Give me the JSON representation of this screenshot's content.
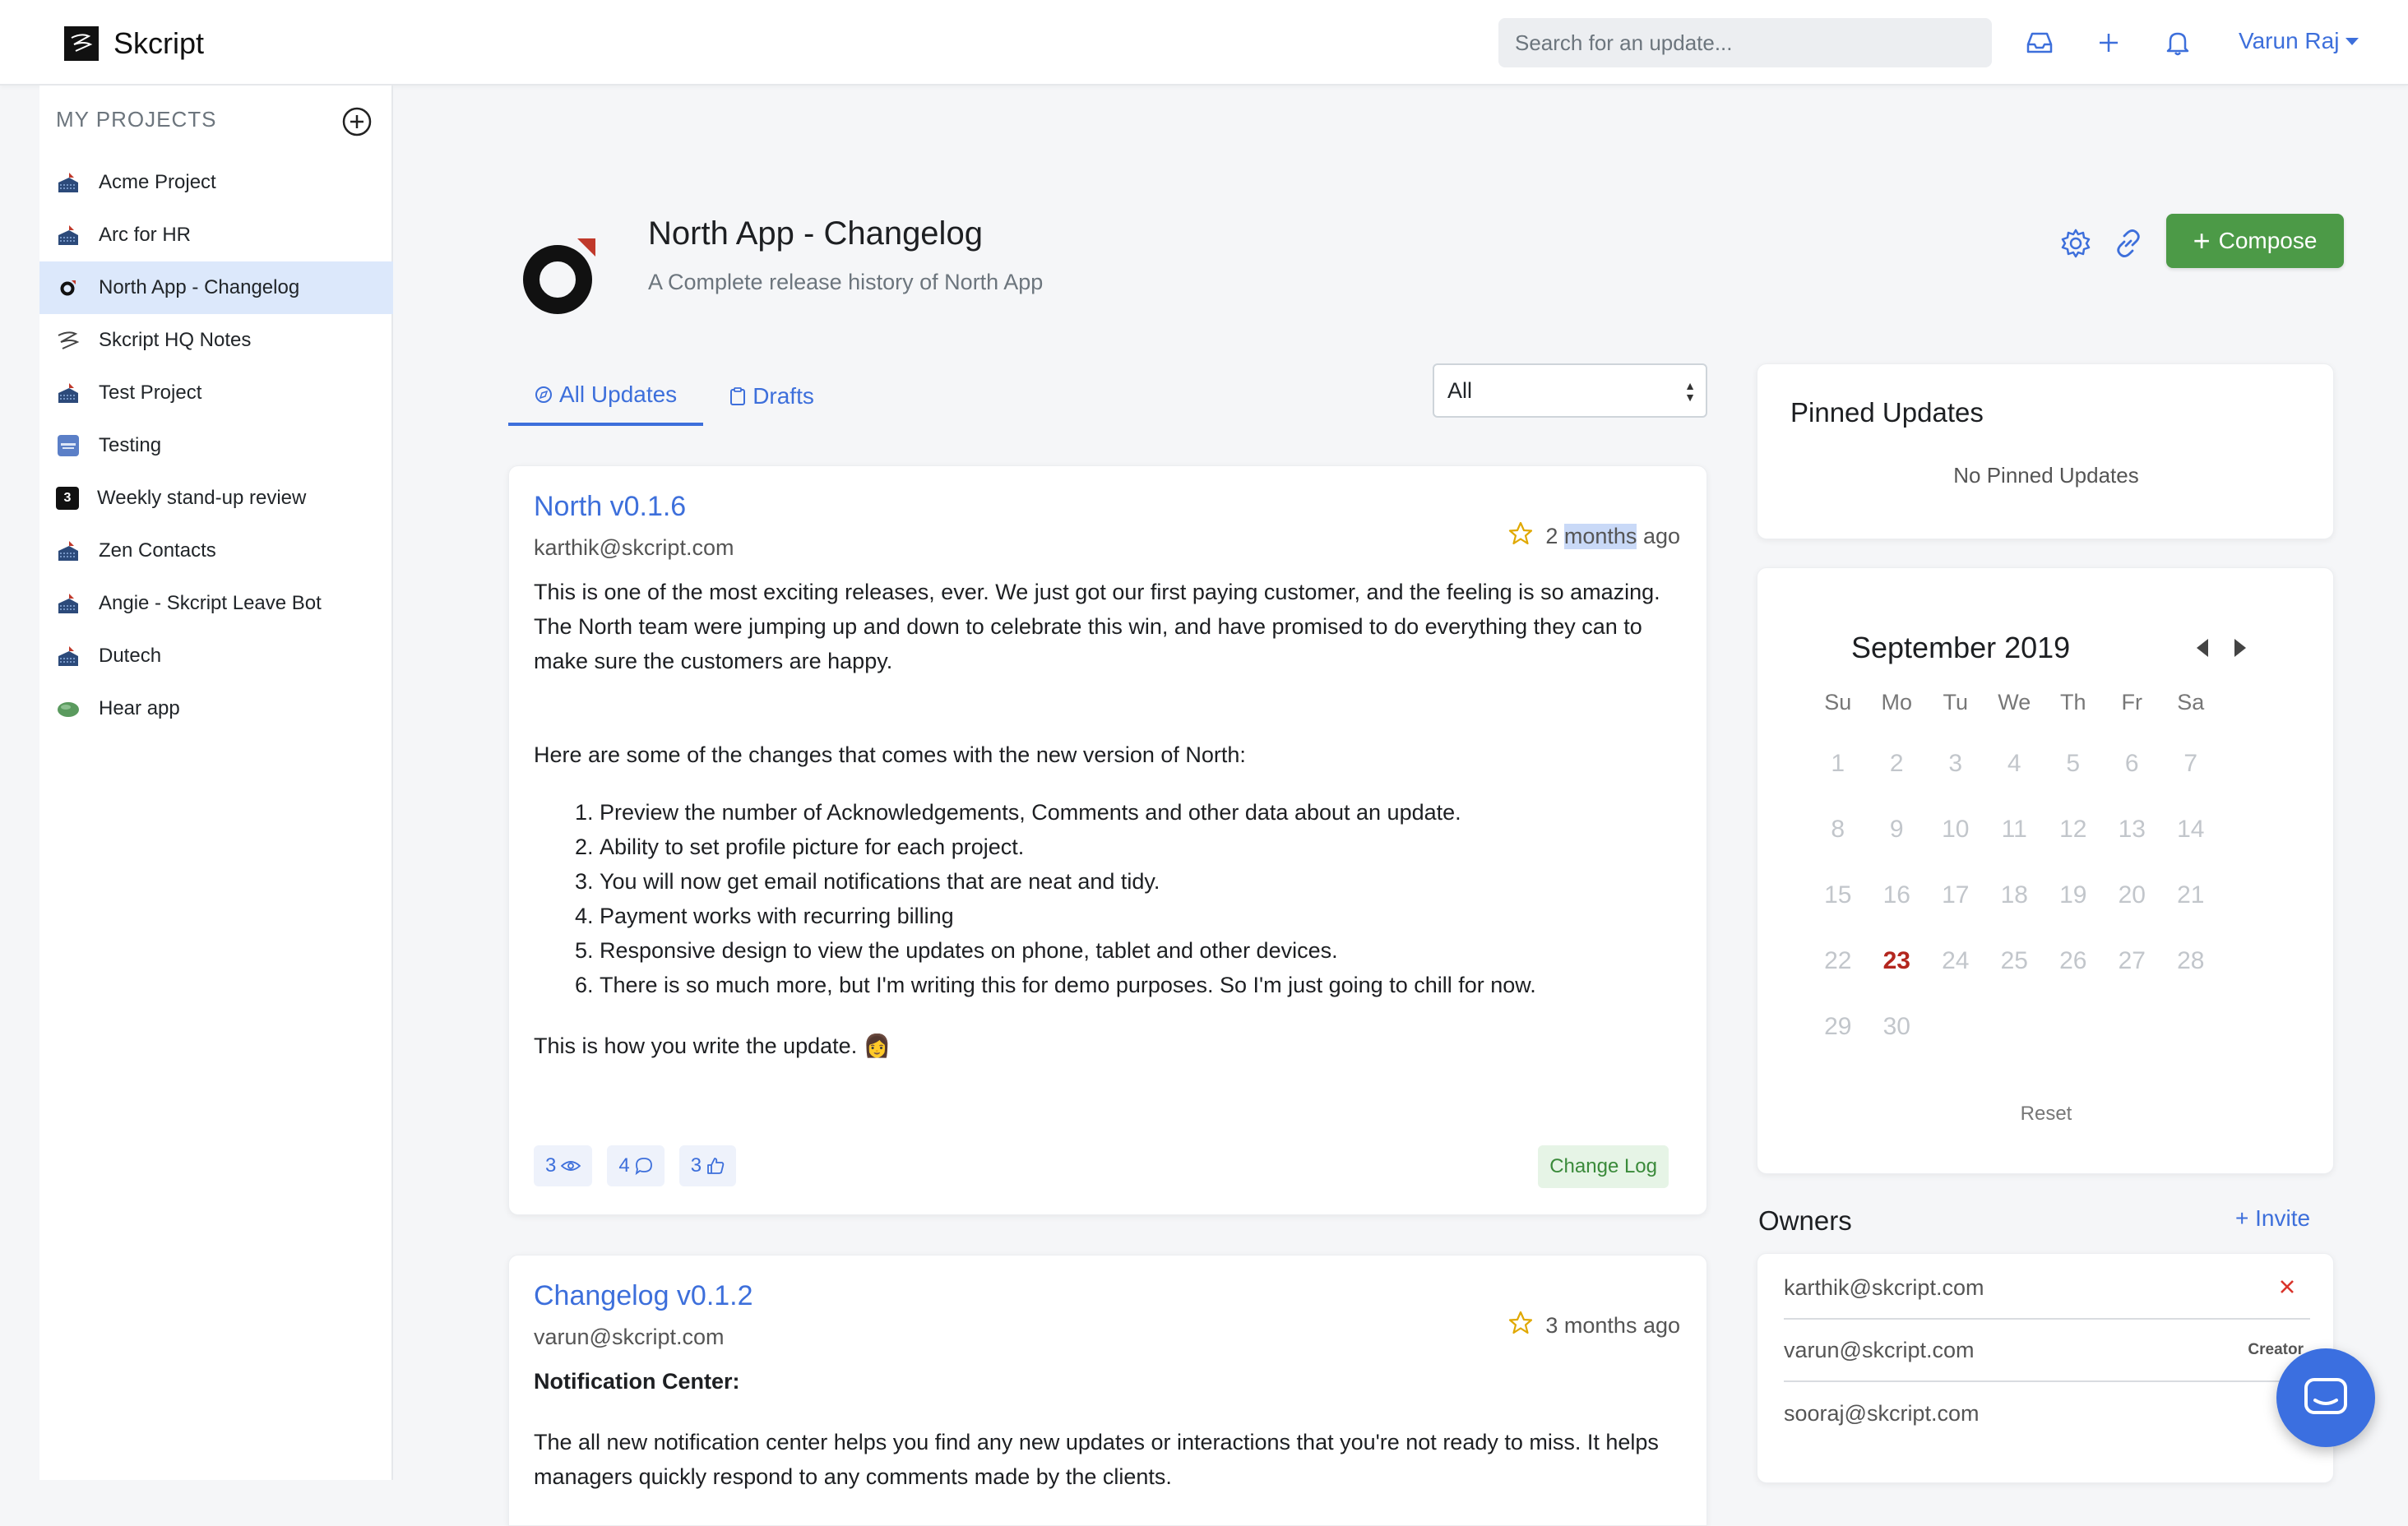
{
  "nav": {
    "brand": "Skcript",
    "search_placeholder": "Search for an update...",
    "user": "Varun Raj"
  },
  "sidebar": {
    "heading": "MY PROJECTS",
    "items": [
      {
        "label": "Acme Project",
        "icon": "ship-icon"
      },
      {
        "label": "Arc for HR",
        "icon": "ship-icon"
      },
      {
        "label": "North App - Changelog",
        "icon": "north-logo-icon",
        "active": true
      },
      {
        "label": "Skcript HQ Notes",
        "icon": "skcript-logo-icon"
      },
      {
        "label": "Test Project",
        "icon": "ship-icon"
      },
      {
        "label": "Testing",
        "icon": "app-tile-icon"
      },
      {
        "label": "Weekly stand-up review",
        "icon": "number-tile-icon"
      },
      {
        "label": "Zen Contacts",
        "icon": "ship-icon"
      },
      {
        "label": "Angie - Skcript Leave Bot",
        "icon": "ship-icon"
      },
      {
        "label": "Dutech",
        "icon": "ship-icon"
      },
      {
        "label": "Hear app",
        "icon": "leaf-icon"
      }
    ],
    "number_tile_text": "3"
  },
  "project": {
    "title": "North App - Changelog",
    "subtitle": "A Complete release history of North App",
    "compose_label": "Compose"
  },
  "tabs": [
    {
      "label": "All Updates",
      "active": true
    },
    {
      "label": "Drafts"
    }
  ],
  "filter": {
    "selected": "All"
  },
  "posts": [
    {
      "title": "North v0.1.6",
      "author": "karthik@skcript.com",
      "time_prefix": "2",
      "time_highlight": "months",
      "time_suffix": "ago",
      "para1": "This is one of the most exciting releases, ever. We just got our first paying customer, and the feeling is so amazing. The North team were jumping up and down to celebrate this win, and have promised to do everything they can to make sure the customers are happy.",
      "para2": "Here are some of the changes that comes with the new version of North:",
      "list": [
        "Preview the number of Acknowledgements, Comments and other data about an update.",
        "Ability to set profile picture for each project.",
        "You will now get email notifications that are neat and tidy.",
        "Payment works with recurring billing",
        "Responsive design to view the updates on phone, tablet and other devices.",
        "There is so much more, but I'm writing this for demo purposes. So I'm just going to chill for now."
      ],
      "para3": "This is how you write the update. 👩",
      "views": "3",
      "comments": "4",
      "likes": "3",
      "tag": "Change Log"
    },
    {
      "title": "Changelog v0.1.2",
      "author": "varun@skcript.com",
      "time": "3 months ago",
      "heading": "Notification Center:",
      "para1": "The all new notification center helps you find any new updates or interactions that you're not ready to miss. It helps managers quickly respond to any comments made by the clients."
    }
  ],
  "pinned": {
    "title": "Pinned Updates",
    "empty": "No Pinned Updates"
  },
  "calendar": {
    "title": "September 2019",
    "dow": [
      "Su",
      "Mo",
      "Tu",
      "We",
      "Th",
      "Fr",
      "Sa"
    ],
    "days": [
      "1",
      "2",
      "3",
      "4",
      "5",
      "6",
      "7",
      "8",
      "9",
      "10",
      "11",
      "12",
      "13",
      "14",
      "15",
      "16",
      "17",
      "18",
      "19",
      "20",
      "21",
      "22",
      "23",
      "24",
      "25",
      "26",
      "27",
      "28",
      "29",
      "30"
    ],
    "today": "23",
    "reset": "Reset"
  },
  "owners": {
    "title": "Owners",
    "invite": "Invite",
    "list": [
      {
        "email": "karthik@skcript.com",
        "action": "remove"
      },
      {
        "email": "varun@skcript.com",
        "role": "Creator"
      },
      {
        "email": "sooraj@skcript.com"
      }
    ]
  },
  "colors": {
    "accent": "#3d6fdb",
    "compose": "#4c9a47",
    "today": "#b3261e"
  }
}
